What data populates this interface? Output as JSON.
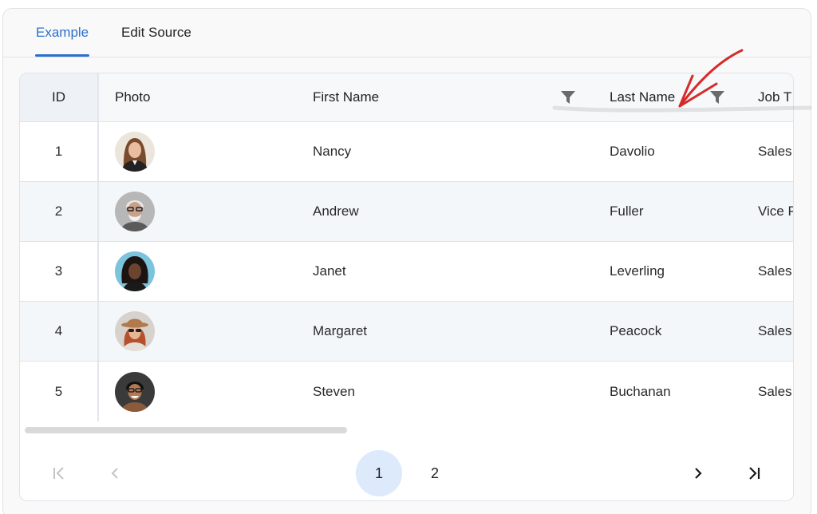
{
  "tabs": [
    {
      "label": "Example",
      "active": true
    },
    {
      "label": "Edit Source",
      "active": false
    }
  ],
  "columns": {
    "id": "ID",
    "photo": "Photo",
    "first_name": "First Name",
    "last_name": "Last Name",
    "job_title": "Job T"
  },
  "rows": [
    {
      "id": "1",
      "first_name": "Nancy",
      "last_name": "Davolio",
      "job_title": "Sales"
    },
    {
      "id": "2",
      "first_name": "Andrew",
      "last_name": "Fuller",
      "job_title": "Vice P"
    },
    {
      "id": "3",
      "first_name": "Janet",
      "last_name": "Leverling",
      "job_title": "Sales"
    },
    {
      "id": "4",
      "first_name": "Margaret",
      "last_name": "Peacock",
      "job_title": "Sales"
    },
    {
      "id": "5",
      "first_name": "Steven",
      "last_name": "Buchanan",
      "job_title": "Sales"
    }
  ],
  "pager": {
    "pages": [
      "1",
      "2"
    ],
    "current_page": "1"
  },
  "colors": {
    "accent": "#2b6fce",
    "active_page_bg": "#dceafc",
    "annotation_arrow": "#d62b2b"
  },
  "icons": {
    "filter": "filter-icon",
    "first_page": "first-page-icon",
    "prev_page": "chevron-left-icon",
    "next_page": "chevron-right-icon",
    "last_page": "last-page-icon"
  }
}
